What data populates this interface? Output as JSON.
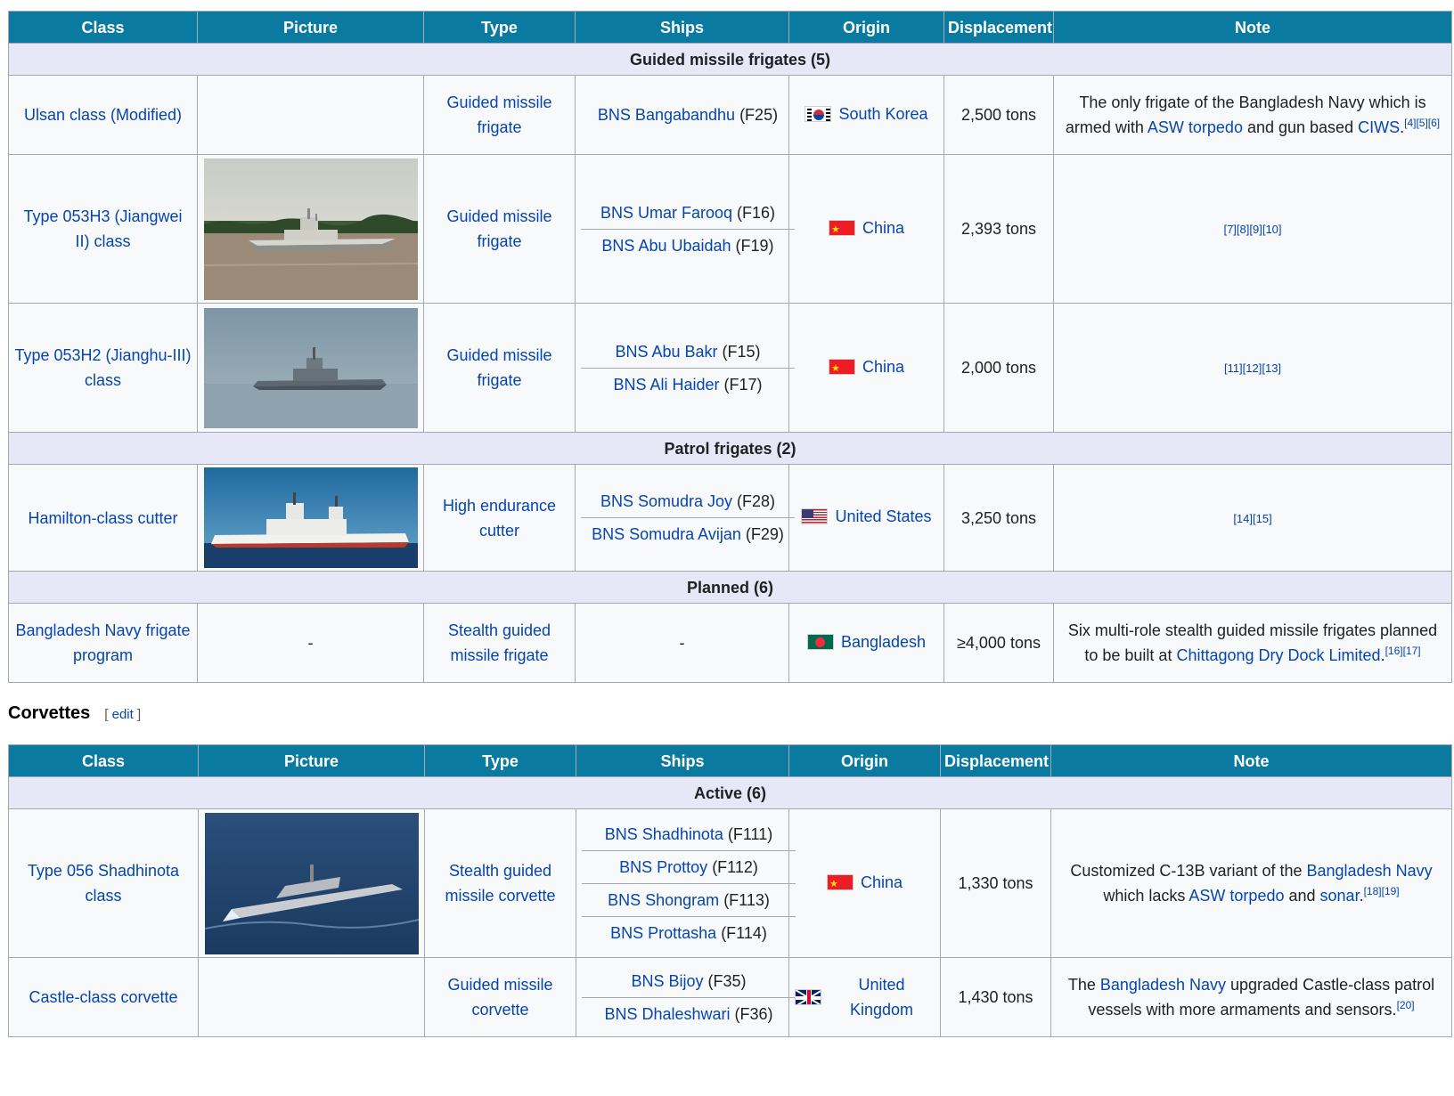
{
  "headers": [
    "Class",
    "Picture",
    "Type",
    "Ships",
    "Origin",
    "Displacement",
    "Note"
  ],
  "frigates": {
    "sections": {
      "guided": "Guided missile frigates (5)",
      "patrol": "Patrol frigates (2)",
      "planned": "Planned (6)"
    },
    "rows": [
      {
        "class": "Ulsan class (Modified)",
        "type": "Guided missile frigate",
        "ships": [
          {
            "name": "BNS Bangabandhu",
            "pennant": "(F25)"
          }
        ],
        "origin": "South Korea",
        "flag": "kr",
        "displacement": "2,500 tons",
        "note": {
          "pre": "The only frigate of the Bangladesh Navy which is armed with ",
          "link1": "ASW torpedo",
          "mid": " and gun based ",
          "link2": "CIWS",
          "post": ".",
          "refs": "[4][5][6]"
        }
      },
      {
        "class": "Type 053H3 (Jiangwei II) class",
        "type": "Guided missile frigate",
        "ships": [
          {
            "name": "BNS Umar Farooq",
            "pennant": "(F16)"
          },
          {
            "name": "BNS Abu Ubaidah",
            "pennant": "(F19)"
          }
        ],
        "origin": "China",
        "flag": "cn",
        "displacement": "2,393 tons",
        "refs": "[7][8][9][10]"
      },
      {
        "class": "Type 053H2 (Jianghu-III) class",
        "type": "Guided missile frigate",
        "ships": [
          {
            "name": "BNS Abu Bakr",
            "pennant": "(F15)"
          },
          {
            "name": "BNS Ali Haider",
            "pennant": "(F17)"
          }
        ],
        "origin": "China",
        "flag": "cn",
        "displacement": "2,000 tons",
        "refs": "[11][12][13]"
      },
      {
        "class": "Hamilton-class cutter",
        "type": "High endurance cutter",
        "ships": [
          {
            "name": "BNS Somudra Joy",
            "pennant": "(F28)"
          },
          {
            "name": "BNS Somudra Avijan",
            "pennant": "(F29)"
          }
        ],
        "origin": "United States",
        "flag": "us",
        "displacement": "3,250 tons",
        "refs": "[14][15]"
      },
      {
        "class": "Bangladesh Navy frigate program",
        "picture": "-",
        "type": "Stealth guided missile frigate",
        "ships_text": "-",
        "origin": "Bangladesh",
        "flag": "bd",
        "displacement": "≥4,000 tons",
        "note": {
          "pre": "Six multi-role stealth guided missile frigates planned to be built at ",
          "link1": "Chittagong Dry Dock Limited",
          "post": ".",
          "refs": "[16][17]"
        }
      }
    ]
  },
  "corvettes": {
    "heading": "Corvettes",
    "edit_open": "[ ",
    "edit_label": "edit",
    "edit_close": " ]",
    "section_active": "Active (6)",
    "rows": [
      {
        "class": "Type 056 Shadhinota class",
        "type": "Stealth guided missile corvette",
        "ships": [
          {
            "name": "BNS Shadhinota",
            "pennant": "(F111)"
          },
          {
            "name": "BNS Prottoy",
            "pennant": "(F112)"
          },
          {
            "name": "BNS Shongram",
            "pennant": "(F113)"
          },
          {
            "name": "BNS Prottasha",
            "pennant": "(F114)"
          }
        ],
        "origin": "China",
        "flag": "cn",
        "displacement": "1,330 tons",
        "note": {
          "pre": "Customized C-13B variant of the ",
          "link1": "Bangladesh Navy",
          "mid": " which lacks ",
          "link2": "ASW torpedo",
          "mid2": " and ",
          "link3": "sonar",
          "post": ".",
          "refs": "[18][19]"
        }
      },
      {
        "class": "Castle-class corvette",
        "type": "Guided missile corvette",
        "ships": [
          {
            "name": "BNS Bijoy",
            "pennant": "(F35)"
          },
          {
            "name": "BNS Dhaleshwari",
            "pennant": "(F36)"
          }
        ],
        "origin": "United Kingdom",
        "flag": "uk",
        "displacement": "1,430 tons",
        "note": {
          "pre": "The ",
          "link1": "Bangladesh Navy",
          "post_text": " upgraded Castle-class patrol vessels with more armaments and sensors.",
          "refs": "[20]"
        }
      }
    ]
  }
}
